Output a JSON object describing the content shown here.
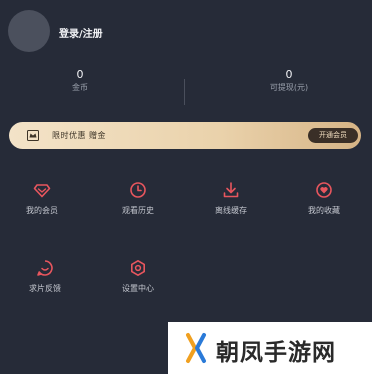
{
  "user": {
    "login_label": "登录/注册"
  },
  "stats": [
    {
      "value": "0",
      "label": "金币"
    },
    {
      "value": "0",
      "label": "可提现(元)"
    }
  ],
  "promo": {
    "text": "限时优惠 赠金",
    "button_label": "开通会员"
  },
  "menu": [
    {
      "label": "我的会员",
      "icon": "diamond-icon"
    },
    {
      "label": "观看历史",
      "icon": "clock-icon"
    },
    {
      "label": "离线缓存",
      "icon": "download-icon"
    },
    {
      "label": "我的收藏",
      "icon": "heart-icon"
    },
    {
      "label": "求片反馈",
      "icon": "feedback-icon"
    },
    {
      "label": "设置中心",
      "icon": "settings-icon"
    }
  ],
  "watermark": {
    "text": "朝凤手游网"
  },
  "colors": {
    "background": "#262b38",
    "accent": "#e8565e",
    "banner_gold": "#ead2ab"
  }
}
